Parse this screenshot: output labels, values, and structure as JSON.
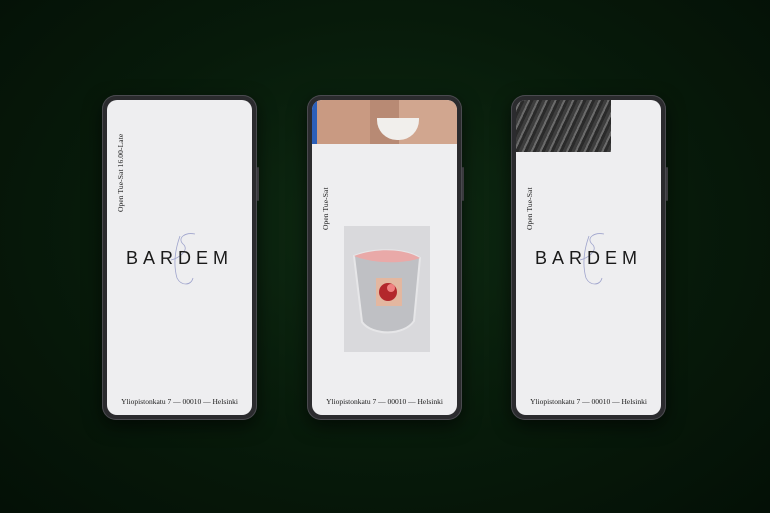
{
  "phones": [
    {
      "hours": "Open Tue-Sat 16.00-Late",
      "logo": "BARDEM",
      "address": "Yliopistonkatu 7 — 00010 — Helsinki"
    },
    {
      "hours": "Open Tue-Sat",
      "address": "Yliopistonkatu 7 — 00010 — Helsinki"
    },
    {
      "hours": "Open Tue-Sat",
      "logo": "BARDEM",
      "address": "Yliopistonkatu 7 — 00010 — Helsinki"
    }
  ],
  "colors": {
    "background": "#071a0a",
    "screen": "#eeeef0",
    "text": "#1a1a1a"
  }
}
